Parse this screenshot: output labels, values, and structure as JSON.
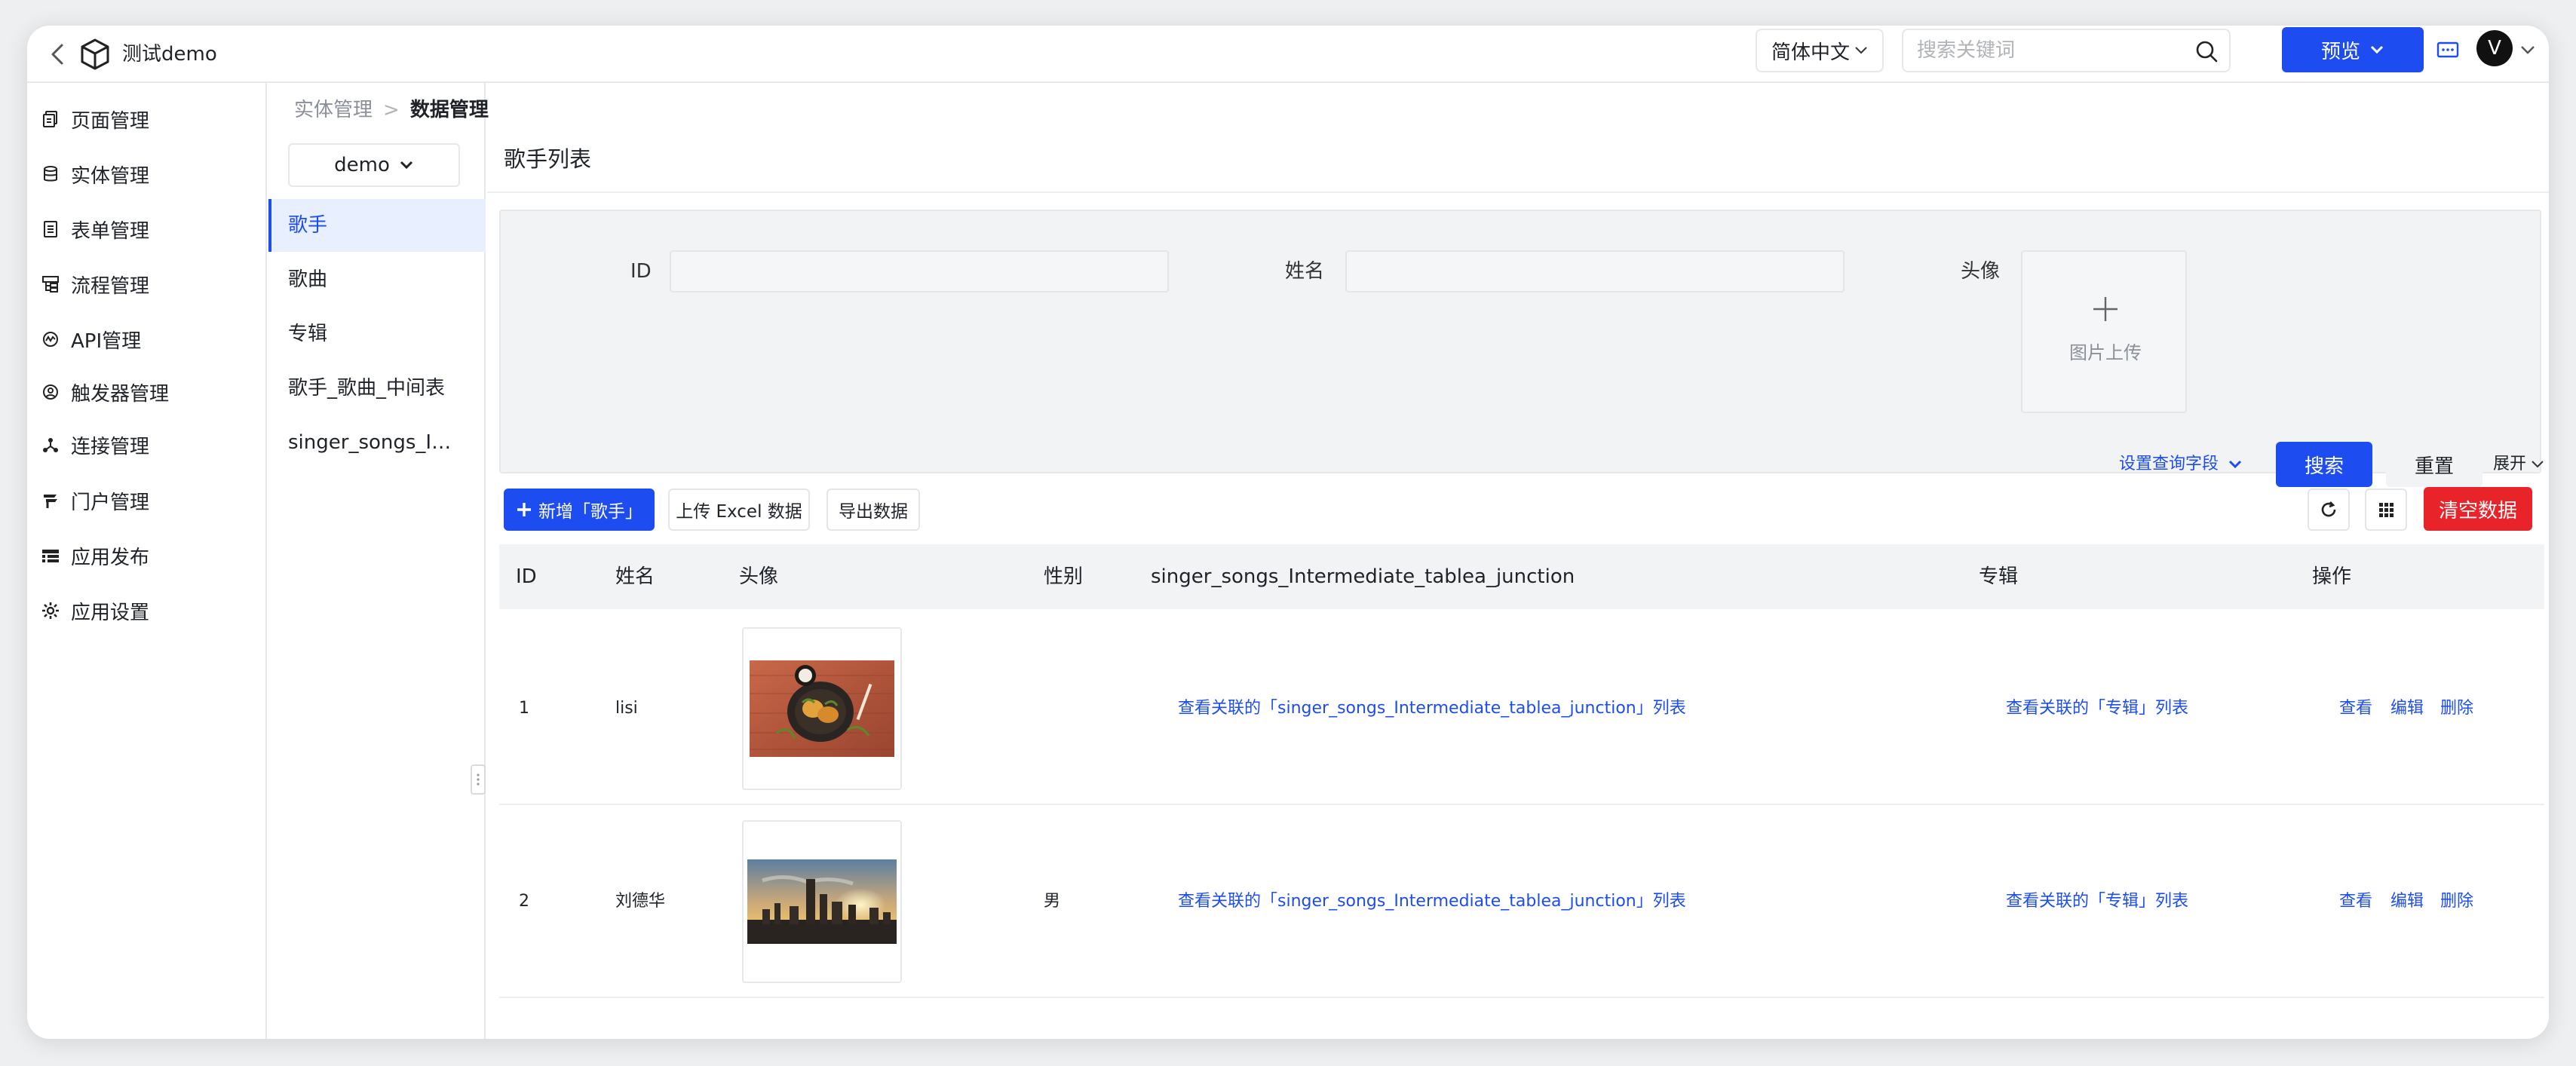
{
  "header": {
    "app_title": "测试demo",
    "language": "简体中文",
    "search_placeholder": "搜索关键词",
    "preview_label": "预览",
    "avatar_initial": "V"
  },
  "nav": {
    "items": [
      {
        "label": "页面管理",
        "icon": "page-icon"
      },
      {
        "label": "实体管理",
        "icon": "database-icon"
      },
      {
        "label": "表单管理",
        "icon": "form-icon"
      },
      {
        "label": "流程管理",
        "icon": "flow-icon"
      },
      {
        "label": "API管理",
        "icon": "api-icon"
      },
      {
        "label": "触发器管理",
        "icon": "trigger-icon"
      },
      {
        "label": "连接管理",
        "icon": "connection-icon"
      },
      {
        "label": "门户管理",
        "icon": "portal-icon"
      },
      {
        "label": "应用发布",
        "icon": "publish-icon"
      },
      {
        "label": "应用设置",
        "icon": "gear-icon"
      }
    ]
  },
  "breadcrumb": {
    "parent": "实体管理",
    "separator": ">",
    "current": "数据管理"
  },
  "entities": {
    "app_select": "demo",
    "items": [
      "歌手",
      "歌曲",
      "专辑",
      "歌手_歌曲_中间表",
      "singer_songs_Intermediate_tablea_junction"
    ],
    "active_index": 0
  },
  "main": {
    "title": "歌手列表",
    "query": {
      "id_label": "ID",
      "name_label": "姓名",
      "avatar_label": "头像",
      "upload_text": "图片上传",
      "set_fields": "设置查询字段",
      "search": "搜索",
      "reset": "重置",
      "expand": "展开"
    },
    "toolbar": {
      "add": "新增「歌手」",
      "upload_excel": "上传 Excel 数据",
      "export": "导出数据",
      "clear": "清空数据"
    },
    "table": {
      "columns": [
        "ID",
        "姓名",
        "头像",
        "性别",
        "singer_songs_Intermediate_tablea_junction",
        "专辑",
        "操作"
      ],
      "rows": [
        {
          "id": "1",
          "name": "lisi",
          "avatar": "food-photo",
          "gender": "",
          "junction_link": "查看关联的「singer_songs_Intermediate_tablea_junction」列表",
          "album_link": "查看关联的「专辑」列表"
        },
        {
          "id": "2",
          "name": "刘德华",
          "avatar": "city-skyline-photo",
          "gender": "男",
          "junction_link": "查看关联的「singer_songs_Intermediate_tablea_junction」列表",
          "album_link": "查看关联的「专辑」列表"
        }
      ],
      "actions": {
        "view": "查看",
        "edit": "编辑",
        "delete": "删除"
      }
    }
  },
  "colors": {
    "primary": "#1d4df0",
    "danger": "#e8242a",
    "active_bg": "#e8efff"
  }
}
